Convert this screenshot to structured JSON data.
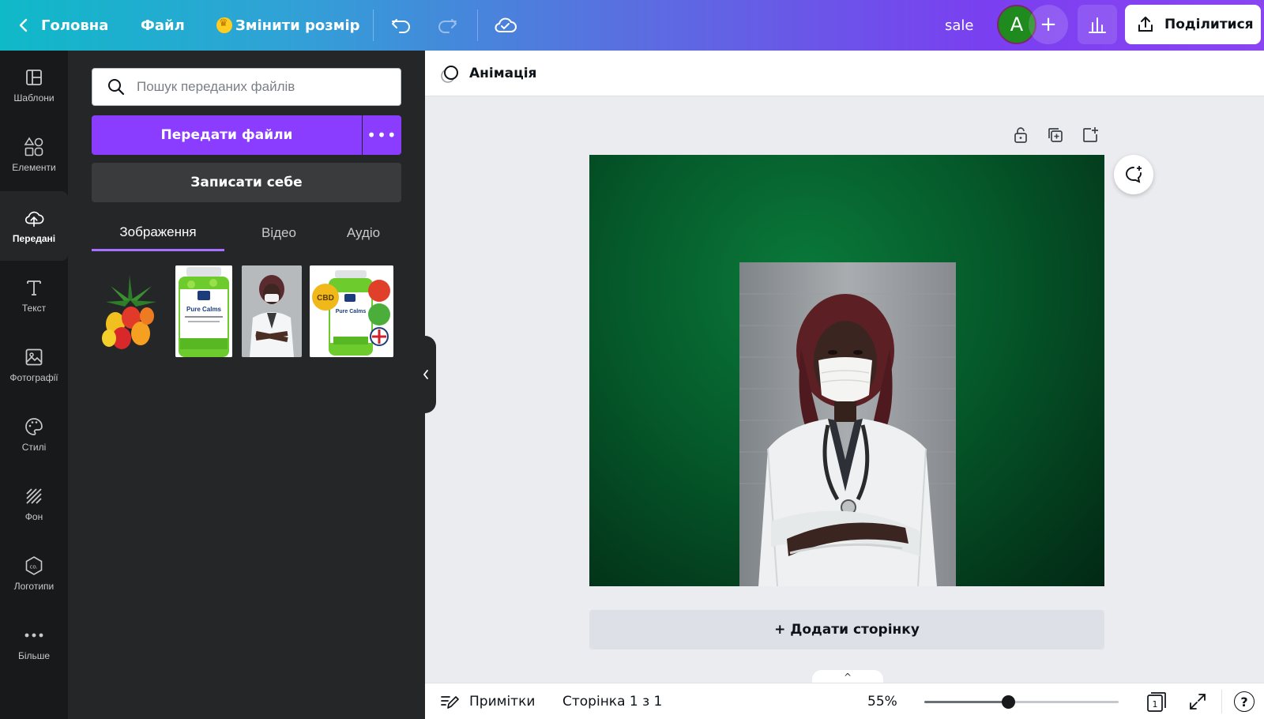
{
  "topbar": {
    "home_label": "Головна",
    "file_label": "Файл",
    "resize_label": "Змінити розмір",
    "design_name": "sale",
    "avatar_initial": "A",
    "share_label": "Поділитися"
  },
  "rail": {
    "items": [
      {
        "label": "Шаблони",
        "icon": "templates-icon"
      },
      {
        "label": "Елементи",
        "icon": "elements-icon"
      },
      {
        "label": "Передані",
        "icon": "uploads-icon"
      },
      {
        "label": "Текст",
        "icon": "text-icon"
      },
      {
        "label": "Фотографії",
        "icon": "photos-icon"
      },
      {
        "label": "Стилі",
        "icon": "styles-icon"
      },
      {
        "label": "Фон",
        "icon": "background-icon"
      },
      {
        "label": "Логотипи",
        "icon": "logos-icon"
      },
      {
        "label": "Більше",
        "icon": "more-icon"
      }
    ],
    "active_index": 2
  },
  "panel": {
    "search_placeholder": "Пошук переданих файлів",
    "upload_label": "Передати файли",
    "record_label": "Записати себе",
    "tabs": [
      "Зображення",
      "Відео",
      "Аудіо"
    ],
    "active_tab": 0,
    "thumbnails": [
      {
        "name": "gummies-cannabis-image"
      },
      {
        "name": "pure-calms-bottle-image"
      },
      {
        "name": "doctor-mask-image"
      },
      {
        "name": "pure-calms-badges-image",
        "badge_text": "CBD"
      }
    ],
    "product_text": "Pure Calms"
  },
  "animation": {
    "label": "Анімація"
  },
  "canvas": {
    "add_page_label": "+ Додати сторінку"
  },
  "bottombar": {
    "notes_label": "Примітки",
    "page_label": "Сторінка 1 з 1",
    "zoom_label": "55%",
    "zoom_level": 0.55,
    "page_count": "1",
    "help_label": "?"
  },
  "colors": {
    "accent": "#8b3dff",
    "panel_bg": "#252627",
    "rail_bg": "#18191b",
    "design_bg": "#05592a"
  }
}
